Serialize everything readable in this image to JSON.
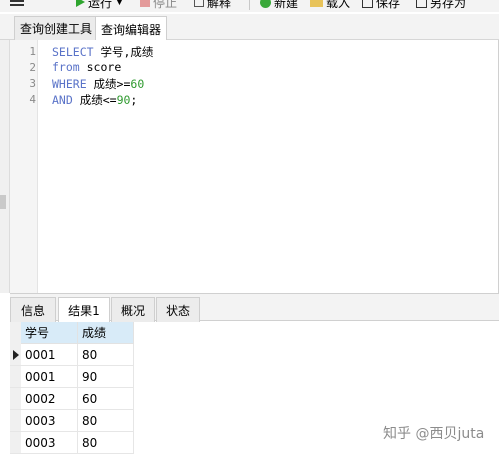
{
  "toolbar": {
    "run_label": "运行",
    "stop_label": "停止",
    "explain_label": "解释",
    "new_label": "新建",
    "load_label": "载入",
    "save_label": "保存",
    "save_as_label": "另存为"
  },
  "tabs": {
    "query_builder": "查询创建工具",
    "query_editor": "查询编辑器"
  },
  "editor": {
    "lines": [
      {
        "num": "1",
        "parts": [
          {
            "t": "SELECT",
            "k": true
          },
          {
            "t": " 学号,成绩",
            "k": false
          }
        ]
      },
      {
        "num": "2",
        "parts": [
          {
            "t": "from",
            "k": true
          },
          {
            "t": " score",
            "k": false
          }
        ]
      },
      {
        "num": "3",
        "parts": [
          {
            "t": "WHERE",
            "k": true
          },
          {
            "t": " 成绩>=",
            "k": false
          },
          {
            "t": "60",
            "n": true
          }
        ]
      },
      {
        "num": "4",
        "parts": [
          {
            "t": "AND",
            "k": true
          },
          {
            "t": " 成绩<=",
            "k": false
          },
          {
            "t": "90",
            "n": true
          },
          {
            "t": ";",
            "k": false
          }
        ]
      }
    ]
  },
  "result_tabs": [
    "信息",
    "结果1",
    "概况",
    "状态"
  ],
  "grid": {
    "columns": [
      "学号",
      "成绩"
    ],
    "rows": [
      [
        "0001",
        "80"
      ],
      [
        "0001",
        "90"
      ],
      [
        "0002",
        "60"
      ],
      [
        "0003",
        "80"
      ],
      [
        "0003",
        "80"
      ]
    ]
  },
  "watermark": "知乎 @西贝juta",
  "colors": {
    "keyword": "#5a73c8",
    "number": "#2e9a2e",
    "header_bg": "#d8ebf8"
  }
}
